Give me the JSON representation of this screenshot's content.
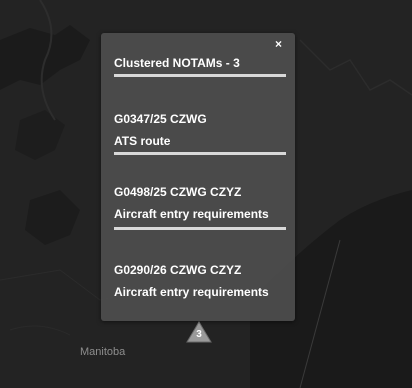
{
  "map": {
    "region_label": "Manitoba"
  },
  "popup": {
    "close_label": "×",
    "title": "Clustered NOTAMs - 3",
    "notams": [
      {
        "id": "G0347/25 CZWG",
        "type": "ATS route"
      },
      {
        "id": "G0498/25 CZWG CZYZ",
        "type": "Aircraft entry requirements"
      },
      {
        "id": "G0290/26 CZWG CZYZ",
        "type": "Aircraft entry requirements"
      }
    ]
  },
  "cluster_marker": {
    "count": "3",
    "icon": "triangle-icon"
  },
  "colors": {
    "map_background": "#232323",
    "popup_background": "#4e4e4e",
    "text": "#ffffff",
    "divider": "#d9d9d9",
    "marker": "#9a9a9a"
  }
}
